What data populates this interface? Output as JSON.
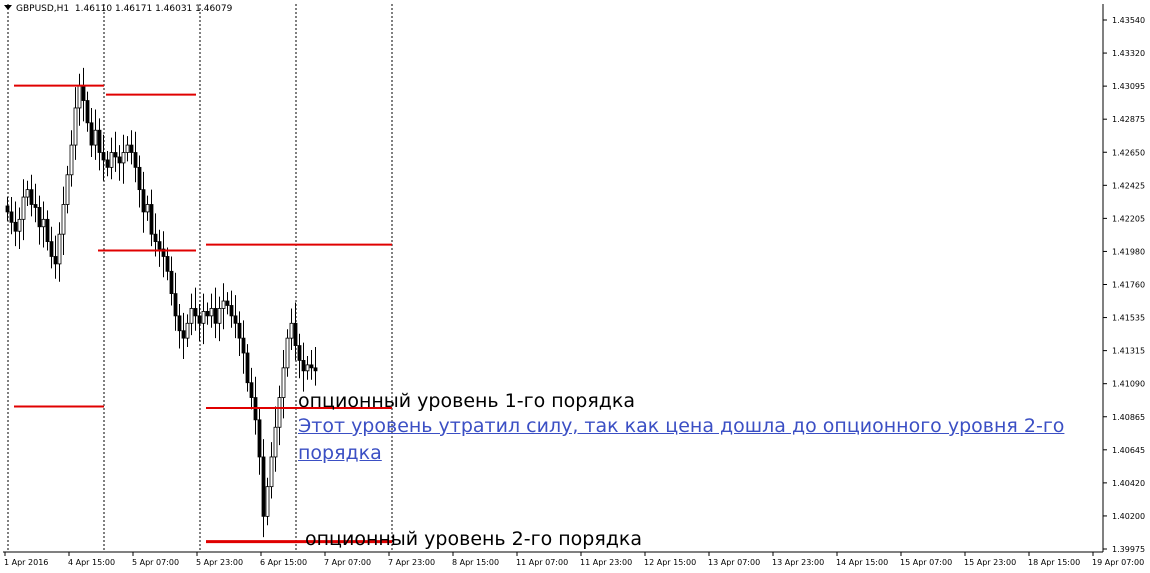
{
  "window": {
    "symbol": "GBPUSD,H1",
    "ohlc": "1.46110 1.46171 1.46031 1.46079"
  },
  "colors": {
    "background": "#ffffff",
    "candle": "#000000",
    "level_line": "#e00000",
    "link": "#3b4fc4"
  },
  "annotations": {
    "level1": "опционный уровень 1-го порядка",
    "link": "Этот уровень утратил силу, так как цена дошла до опционного уровня 2-го порядка",
    "level2": "опционный уровень 2-го порядка"
  },
  "chart_data": {
    "type": "candlestick",
    "y_ticks": [
      "1.43540",
      "1.43320",
      "1.43095",
      "1.42875",
      "1.42650",
      "1.42425",
      "1.42205",
      "1.41980",
      "1.41760",
      "1.41535",
      "1.41315",
      "1.41090",
      "1.40865",
      "1.40645",
      "1.40420",
      "1.40200",
      "1.39975"
    ],
    "x_ticks": [
      "1 Apr 2016",
      "4 Apr 15:00",
      "5 Apr 07:00",
      "5 Apr 23:00",
      "6 Apr 15:00",
      "7 Apr 07:00",
      "7 Apr 23:00",
      "8 Apr 15:00",
      "11 Apr 07:00",
      "11 Apr 23:00",
      "12 Apr 15:00",
      "13 Apr 07:00",
      "13 Apr 23:00",
      "14 Apr 15:00",
      "15 Apr 07:00",
      "15 Apr 23:00",
      "18 Apr 15:00",
      "19 Apr 07:00"
    ],
    "ylim": [
      1.3996,
      1.4365
    ],
    "session_separators_bar_index": [
      0,
      24,
      48,
      72,
      96
    ],
    "levels": [
      {
        "price": 1.431,
        "from_bar": 2,
        "to_bar": 24
      },
      {
        "price": 1.4304,
        "from_bar": 25,
        "to_bar": 47
      },
      {
        "price": 1.4199,
        "from_bar": 23,
        "to_bar": 47
      },
      {
        "price": 1.4203,
        "from_bar": 50,
        "to_bar": 96
      },
      {
        "price": 1.4094,
        "from_bar": 2,
        "to_bar": 24
      },
      {
        "price": 1.4093,
        "from_bar": 50,
        "to_bar": 96
      },
      {
        "price": 1.4003,
        "from_bar": 50,
        "to_bar": 96
      }
    ],
    "closes": [
      1.4225,
      1.4218,
      1.4212,
      1.422,
      1.4235,
      1.424,
      1.423,
      1.4228,
      1.4215,
      1.422,
      1.4205,
      1.4195,
      1.419,
      1.421,
      1.423,
      1.425,
      1.427,
      1.4295,
      1.431,
      1.43,
      1.4285,
      1.427,
      1.428,
      1.4265,
      1.426,
      1.4255,
      1.4265,
      1.4262,
      1.4258,
      1.4265,
      1.427,
      1.4265,
      1.4255,
      1.424,
      1.4225,
      1.423,
      1.421,
      1.4205,
      1.42,
      1.4195,
      1.4185,
      1.417,
      1.4155,
      1.4145,
      1.414,
      1.415,
      1.416,
      1.4155,
      1.415,
      1.4158,
      1.4155,
      1.416,
      1.415,
      1.416,
      1.4165,
      1.4162,
      1.4155,
      1.415,
      1.414,
      1.413,
      1.411,
      1.41,
      1.4085,
      1.406,
      1.402,
      1.404,
      1.406,
      1.408,
      1.41,
      1.412,
      1.414,
      1.415,
      1.4135,
      1.4125,
      1.4118,
      1.4122,
      1.412,
      1.4118
    ]
  }
}
